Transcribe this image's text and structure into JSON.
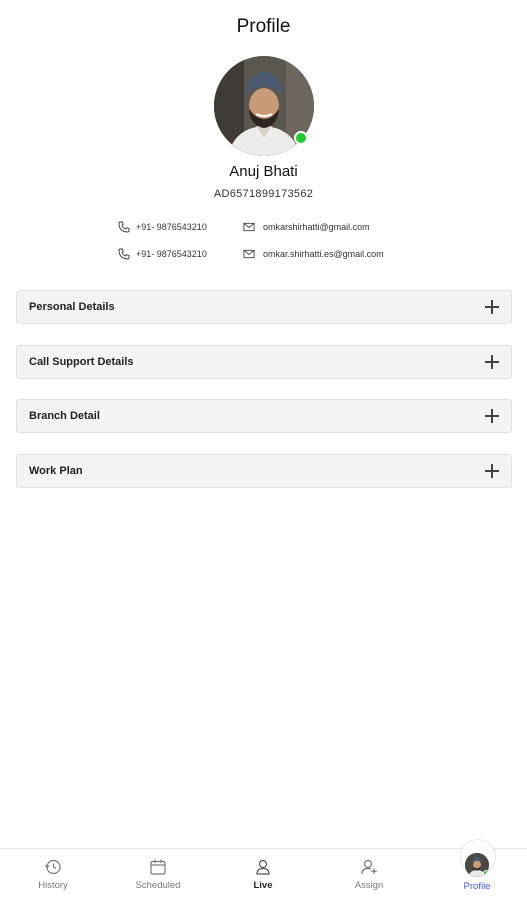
{
  "header": {
    "title": "Profile"
  },
  "user": {
    "name": "Anuj Bhati",
    "id": "AD6571899173562",
    "online_color": "#22c92e"
  },
  "contacts": [
    {
      "phone": "+91- 9876543210",
      "email": "omkarshirhatti@gmail.com"
    },
    {
      "phone": "+91- 9876543210",
      "email": "omkar.shirhatti.es@gmail.com"
    }
  ],
  "sections": [
    {
      "label": "Personal Details",
      "icon": "plus-icon"
    },
    {
      "label": "Call Support Details",
      "icon": "plus-icon"
    },
    {
      "label": "Branch Detail",
      "icon": "plus-icon"
    },
    {
      "label": "Work Plan",
      "icon": "plus-icon"
    }
  ],
  "bottom_nav": {
    "active_color": "#3b5bdb",
    "items": [
      {
        "label": "History",
        "icon": "history-icon"
      },
      {
        "label": "Scheduled",
        "icon": "calendar-icon"
      },
      {
        "label": "Live",
        "icon": "person-icon"
      },
      {
        "label": "Assign",
        "icon": "person-add-icon"
      },
      {
        "label": "Profile",
        "icon": "avatar-icon"
      }
    ]
  }
}
